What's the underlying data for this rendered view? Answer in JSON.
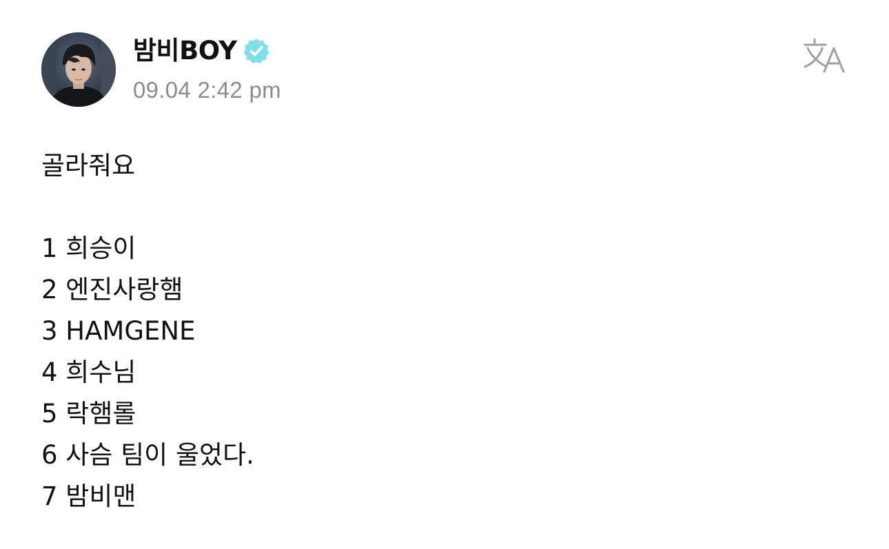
{
  "post": {
    "author_name": "밤비BOY",
    "verified": true,
    "timestamp": "09.04 2:42 pm",
    "title_line": "골라줘요",
    "items": [
      "1 희승이",
      "2 엔진사랑햄",
      "3 HAMGENE",
      "4 희수님",
      "5 락햄롤",
      "6 사슴 팀이 울었다.",
      "7 밤비맨"
    ]
  },
  "icons": {
    "verified": "verified-badge-icon",
    "translate": "translate-icon"
  },
  "colors": {
    "text": "#111111",
    "timestamp": "#8c8c8c",
    "verified_badge": "#7ee0e6",
    "translate_icon": "#a0a0a0"
  }
}
